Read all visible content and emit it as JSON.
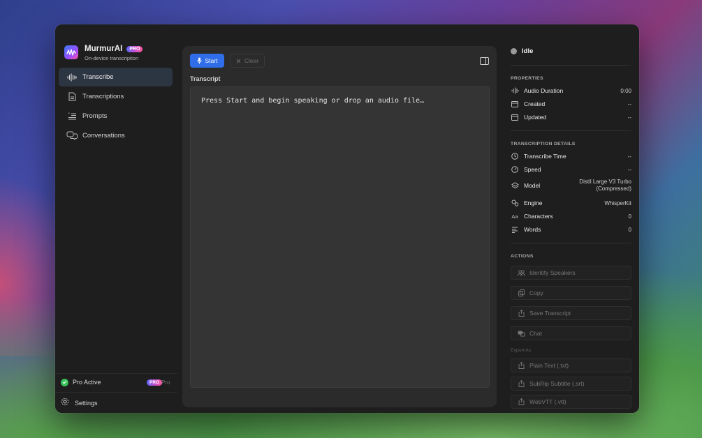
{
  "app": {
    "name": "MurmurAI",
    "badge": "PRO",
    "subtitle": "On-device transcription"
  },
  "sidebar": {
    "items": [
      {
        "label": "Transcribe",
        "icon": "waveform-icon",
        "active": true
      },
      {
        "label": "Transcriptions",
        "icon": "document-icon",
        "active": false
      },
      {
        "label": "Prompts",
        "icon": "prompt-list-icon",
        "active": false
      },
      {
        "label": "Conversations",
        "icon": "chat-bubbles-icon",
        "active": false
      }
    ],
    "pro_status": {
      "label": "Pro Active",
      "badge": "PRO",
      "text": "Pro"
    },
    "settings_label": "Settings"
  },
  "toolbar": {
    "start_label": "Start",
    "clear_label": "Clear"
  },
  "transcript": {
    "label": "Transcript",
    "placeholder": "Press Start and begin speaking or drop an audio file…"
  },
  "inspector": {
    "status": "Idle",
    "properties": {
      "title": "PROPERTIES",
      "rows": [
        {
          "label": "Audio Duration",
          "value": "0:00",
          "icon": "waveform-icon"
        },
        {
          "label": "Created",
          "value": "--",
          "icon": "calendar-icon"
        },
        {
          "label": "Updated",
          "value": "--",
          "icon": "calendar-icon"
        }
      ]
    },
    "details": {
      "title": "TRANSCRIPTION DETAILS",
      "rows": [
        {
          "label": "Transcribe Time",
          "value": "--",
          "icon": "clock-icon"
        },
        {
          "label": "Speed",
          "value": "--",
          "icon": "speedometer-icon"
        },
        {
          "label": "Model",
          "value_line1": "Distil Large V3 Turbo",
          "value_line2": "(Compressed)",
          "icon": "layers-icon"
        },
        {
          "label": "Engine",
          "value": "WhisperKit",
          "icon": "gears-icon"
        },
        {
          "label": "Characters",
          "value": "0",
          "icon": "text-size-icon"
        },
        {
          "label": "Words",
          "value": "0",
          "icon": "text-lines-icon"
        }
      ]
    },
    "actions": {
      "title": "ACTIONS",
      "buttons": [
        {
          "label": "Identify Speakers",
          "icon": "people-icon"
        },
        {
          "label": "Copy",
          "icon": "copy-icon"
        },
        {
          "label": "Save Transcript",
          "icon": "share-icon"
        },
        {
          "label": "Chat",
          "icon": "chat-bubbles-icon"
        }
      ],
      "export_label": "Export As",
      "exports": [
        {
          "label": "Plain Text (.txt)",
          "icon": "share-icon"
        },
        {
          "label": "SubRip Subtitle (.srt)",
          "icon": "share-icon"
        },
        {
          "label": "WebVTT (.vtt)",
          "icon": "share-icon"
        }
      ]
    }
  },
  "colors": {
    "accent": "#2f6ee8",
    "pro_active": "#37c15a",
    "window_bg": "#1e1e1e",
    "panel_bg": "#2b2b2b"
  }
}
